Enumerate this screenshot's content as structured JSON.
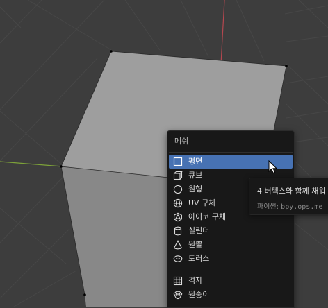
{
  "menu": {
    "title": "메쉬",
    "items": [
      {
        "label": "평면",
        "icon": "plane-icon",
        "active": true
      },
      {
        "label": "큐브",
        "icon": "cube-icon"
      },
      {
        "label": "원형",
        "icon": "circle-icon"
      },
      {
        "label": "UV 구체",
        "icon": "uv-sphere-icon"
      },
      {
        "label": "아이코 구체",
        "icon": "ico-sphere-icon"
      },
      {
        "label": "실린더",
        "icon": "cylinder-icon"
      },
      {
        "label": "원뿔",
        "icon": "cone-icon"
      },
      {
        "label": "토러스",
        "icon": "torus-icon"
      },
      {
        "label": "격자",
        "icon": "grid-icon"
      },
      {
        "label": "원숭이",
        "icon": "monkey-icon"
      }
    ]
  },
  "tooltip": {
    "description": "4 버텍스와 함께 채워",
    "python_label": "파이썬:",
    "python_value": "bpy.ops.me"
  },
  "colors": {
    "viewport_bg": "#3d3d3d",
    "grid_line": "#474747",
    "x_axis": "#b5474f",
    "y_axis": "#7da239",
    "cube_top": "#9e9e9e",
    "cube_front": "#888888",
    "menu_bg": "#181818",
    "highlight": "#4772b3"
  }
}
